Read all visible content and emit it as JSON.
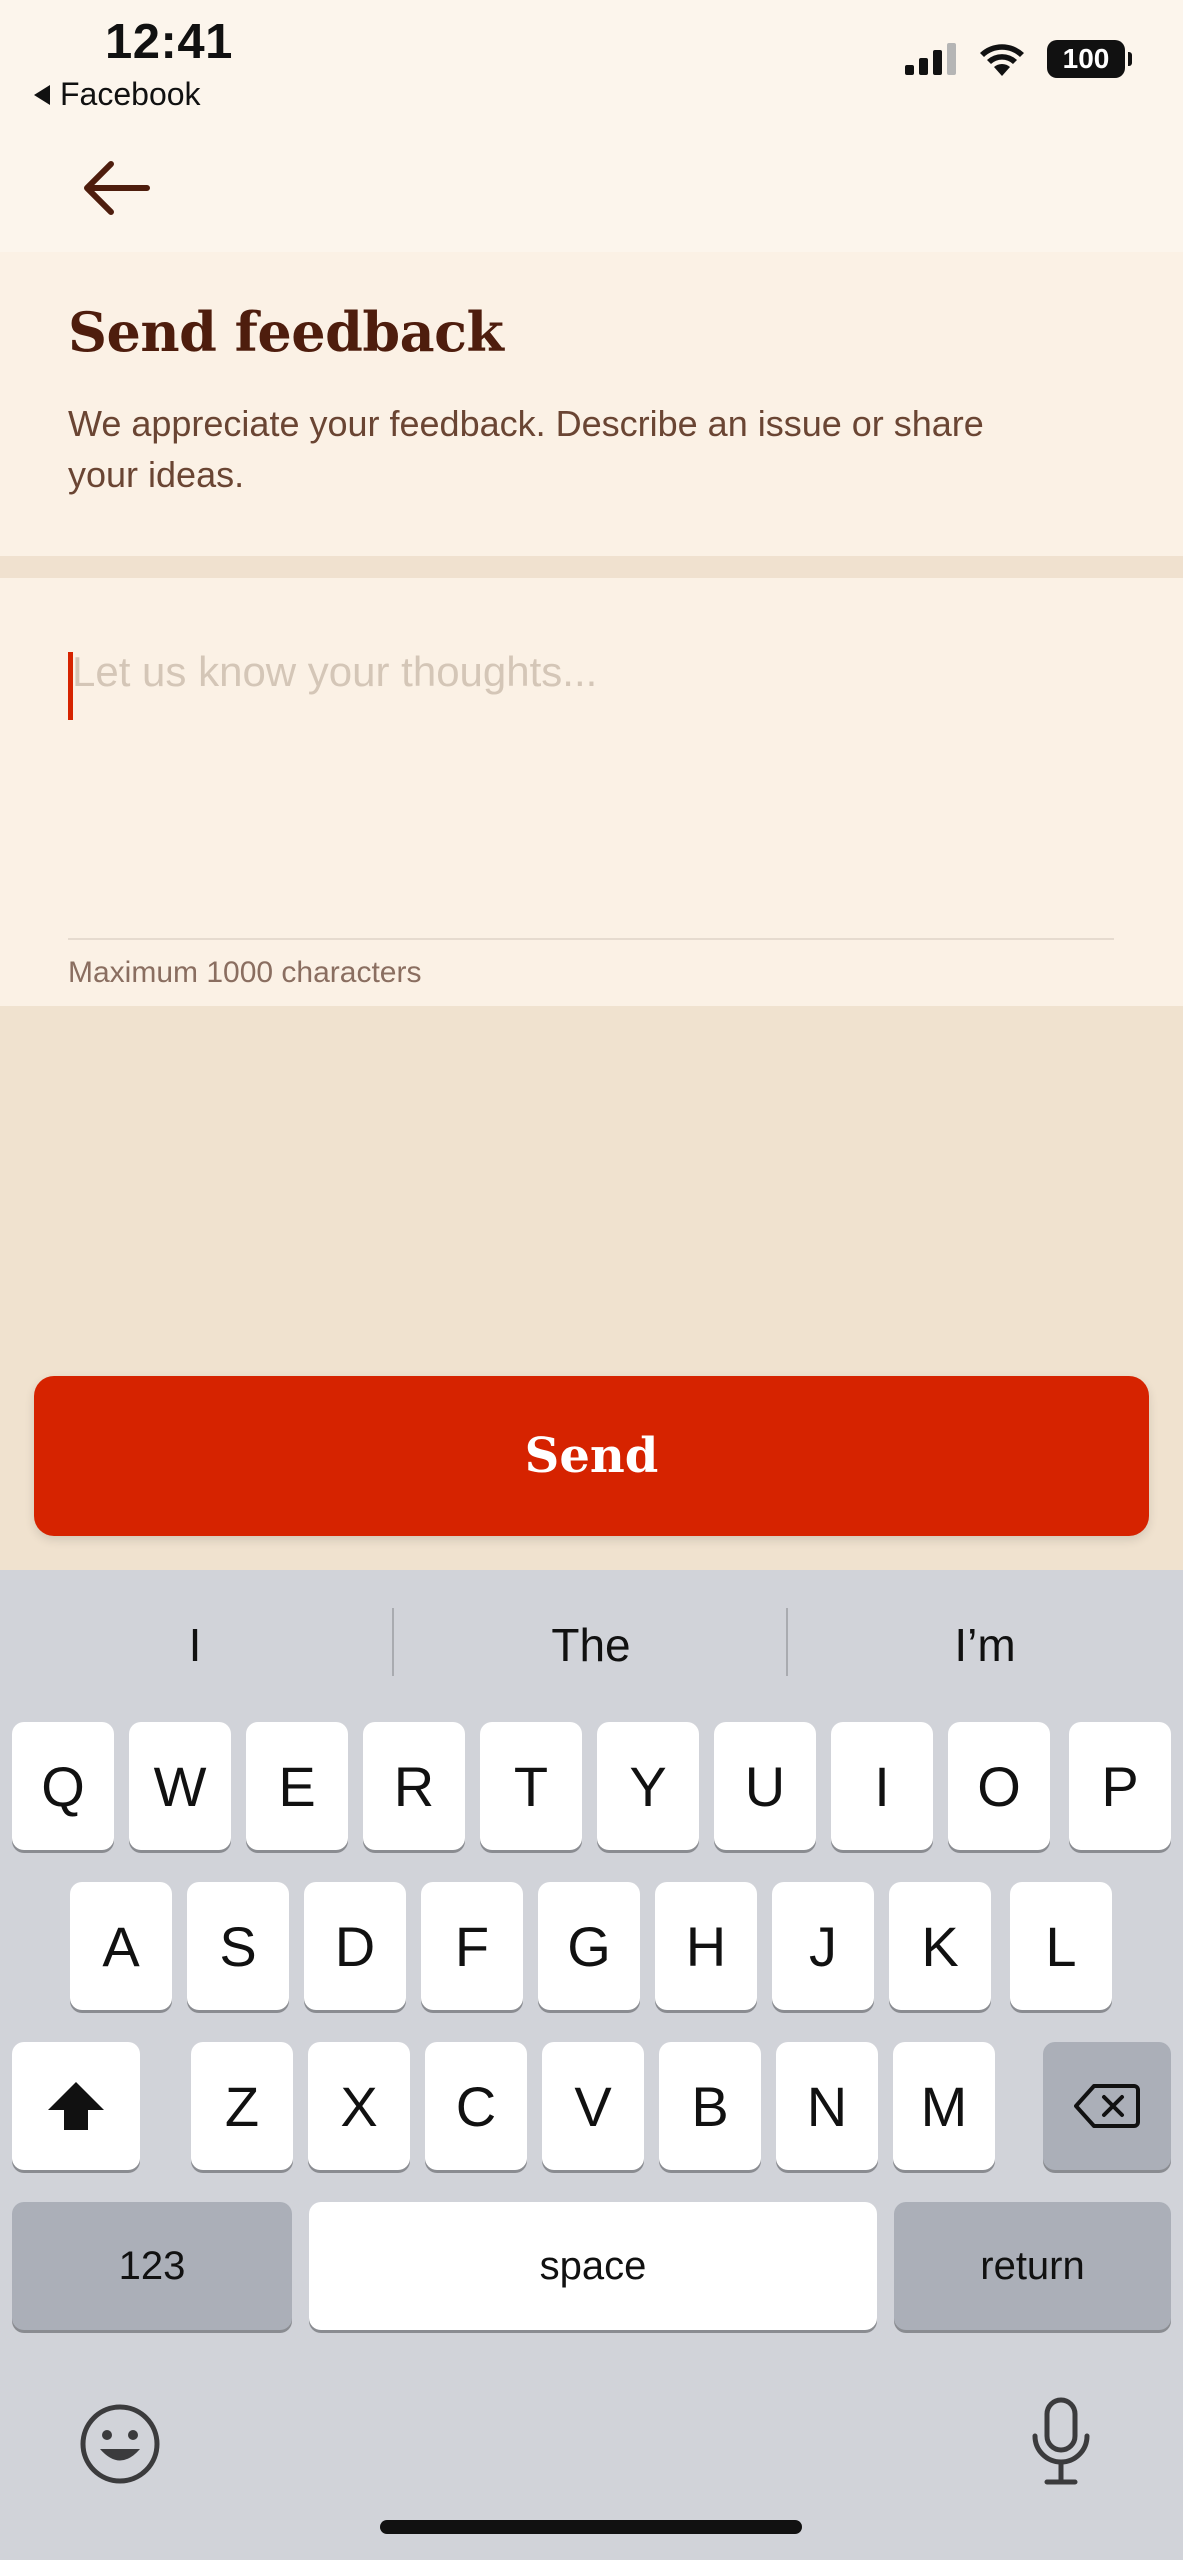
{
  "status_bar": {
    "time": "12:41",
    "back_app": "Facebook",
    "battery": "100",
    "icons": [
      "cellular-signal-icon",
      "wifi-icon",
      "battery-icon"
    ]
  },
  "header": {
    "back_icon": "arrow-left-icon",
    "title": "Send feedback",
    "subtitle": "We appreciate your feedback. Describe an issue or share your ideas."
  },
  "form": {
    "placeholder": "Let us know your thoughts...",
    "value": "",
    "hint": "Maximum 1000 characters",
    "submit_label": "Send"
  },
  "keyboard": {
    "suggestions": [
      "I",
      "The",
      "I’m"
    ],
    "row1": [
      "Q",
      "W",
      "E",
      "R",
      "T",
      "Y",
      "U",
      "I",
      "O",
      "P"
    ],
    "row2": [
      "A",
      "S",
      "D",
      "F",
      "G",
      "H",
      "J",
      "K",
      "L"
    ],
    "row3": [
      "Z",
      "X",
      "C",
      "V",
      "B",
      "N",
      "M"
    ],
    "numbers_label": "123",
    "space_label": "space",
    "return_label": "return"
  },
  "colors": {
    "accent": "#d62300",
    "title": "#4e1d0d",
    "background": "#fcf5ec"
  }
}
